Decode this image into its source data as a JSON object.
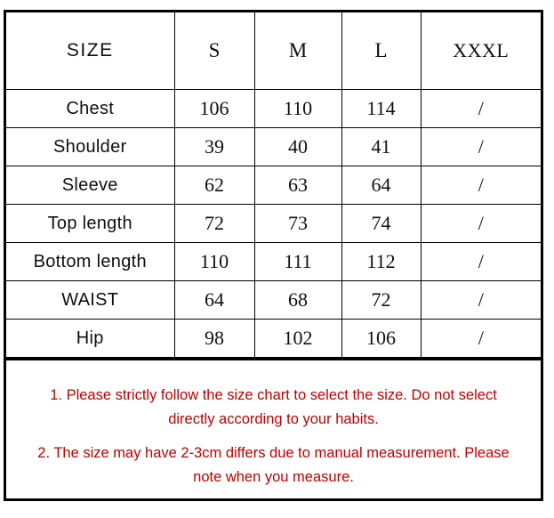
{
  "table": {
    "header": {
      "label_column": "SIZE",
      "size_columns": [
        "S",
        "M",
        "L",
        "XXXL"
      ]
    },
    "rows": [
      {
        "label": "Chest",
        "values": [
          "106",
          "110",
          "114",
          "/"
        ]
      },
      {
        "label": "Shoulder",
        "values": [
          "39",
          "40",
          "41",
          "/"
        ]
      },
      {
        "label": "Sleeve",
        "values": [
          "62",
          "63",
          "64",
          "/"
        ]
      },
      {
        "label": "Top length",
        "values": [
          "72",
          "73",
          "74",
          "/"
        ]
      },
      {
        "label": "Bottom length",
        "values": [
          "110",
          "111",
          "112",
          "/"
        ]
      },
      {
        "label": "WAIST",
        "values": [
          "64",
          "68",
          "72",
          "/"
        ]
      },
      {
        "label": "Hip",
        "values": [
          "98",
          "102",
          "106",
          "/"
        ]
      }
    ]
  },
  "notes": {
    "color": "#C00000",
    "lines": [
      "1. Please strictly follow the size chart  to select the size. Do not select directly according to your habits.",
      "2. The size may have 2-3cm differs due to manual measurement. Please note when you measure."
    ]
  }
}
